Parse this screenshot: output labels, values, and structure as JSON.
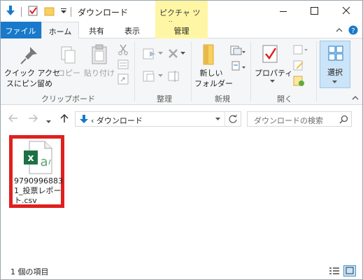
{
  "window": {
    "title": "ダウンロード",
    "context_tab_header": "ピクチャ ツール"
  },
  "tabs": {
    "file": "ファイル",
    "home": "ホーム",
    "share": "共有",
    "view": "表示",
    "manage": "管理"
  },
  "ribbon": {
    "pin_quick_access": "クイック アクセ\nスにピン留め",
    "pin_line1": "クイック アクセ",
    "pin_line2": "スにピン留め",
    "copy": "コピー",
    "paste": "貼り付け",
    "clipboard_group": "クリップボード",
    "organize_group": "整理",
    "new_folder_line1": "新しい",
    "new_folder_line2": "フォルダー",
    "new_group": "新規",
    "properties": "プロパティ",
    "open_group": "開く",
    "select": "選択"
  },
  "address": {
    "path": "‹ ダウンロード",
    "search_placeholder": "ダウンロードの検索"
  },
  "files": [
    {
      "name": "97909968831_投票レポート.csv",
      "icon": "excel-csv-icon"
    }
  ],
  "status": {
    "item_count": "1 個の項目"
  },
  "colors": {
    "file_tab": "#1979ca",
    "context_tab": "#fff6a5",
    "selection_highlight": "#e0201f",
    "select_button": "#cce4f7"
  }
}
